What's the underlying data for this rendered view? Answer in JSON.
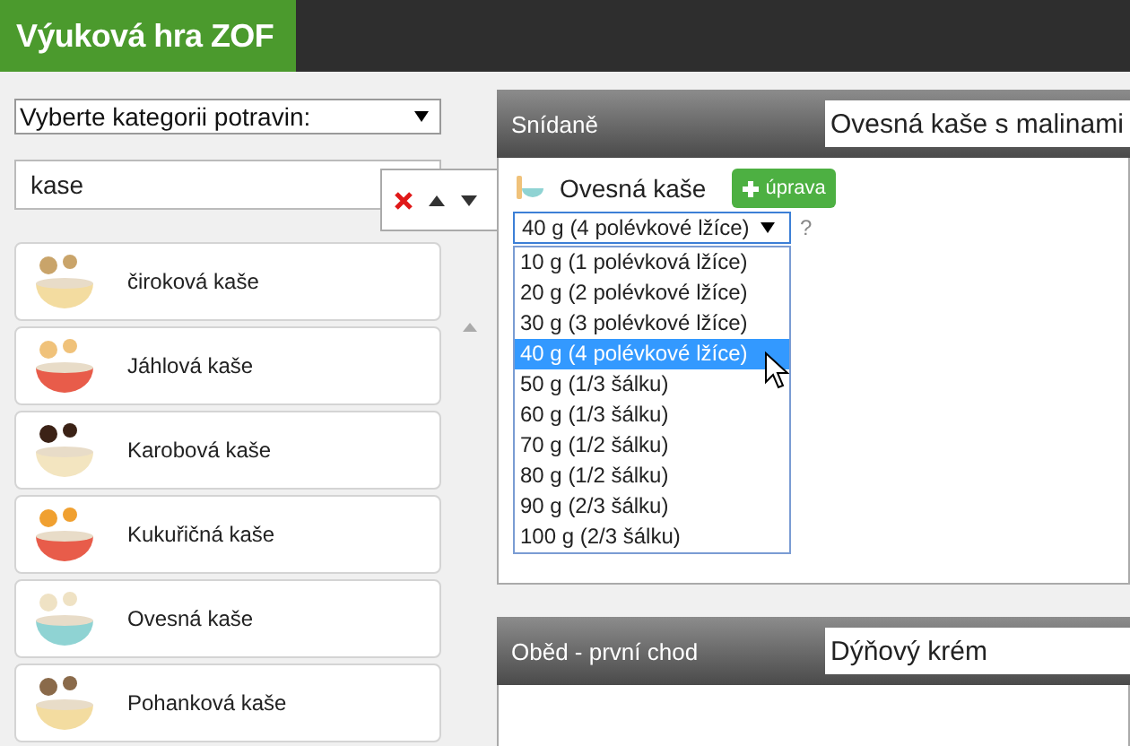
{
  "app": {
    "title": "Výuková hra ZOF"
  },
  "sidebar": {
    "category_select": {
      "value": "Vyberte kategorii potravin:"
    },
    "search": {
      "value": "kase"
    },
    "foods": [
      {
        "name": "čiroková kaše"
      },
      {
        "name": "Jáhlová kaše"
      },
      {
        "name": "Karobová kaše"
      },
      {
        "name": "Kukuřičná kaše"
      },
      {
        "name": "Ovesná kaše"
      },
      {
        "name": "Pohanková kaše"
      }
    ]
  },
  "meals": [
    {
      "title": "Snídaně",
      "dish": "Ovesná kaše s malinami",
      "items": [
        {
          "name": "Ovesná kaše",
          "edit_button": "úprava",
          "help": "?",
          "portion": {
            "value": "40 g (4 polévkové lžíce)",
            "expanded": true,
            "options": [
              {
                "label": "10 g (1 polévková lžíce)",
                "selected": false
              },
              {
                "label": "20 g (2 polévkové lžíce)",
                "selected": false
              },
              {
                "label": "30 g (3 polévkové lžíce)",
                "selected": false
              },
              {
                "label": "40 g (4 polévkové lžíce)",
                "selected": true
              },
              {
                "label": "50 g (1/3 šálku)",
                "selected": false
              },
              {
                "label": "60 g (1/3 šálku)",
                "selected": false
              },
              {
                "label": "70 g (1/2 šálku)",
                "selected": false
              },
              {
                "label": "80 g (1/2 šálku)",
                "selected": false
              },
              {
                "label": "90 g (2/3 šálku)",
                "selected": false
              },
              {
                "label": "100 g (2/3 šálku)",
                "selected": false
              }
            ]
          }
        }
      ]
    },
    {
      "title": "Oběd - první chod",
      "dish": "Dýňový krém"
    }
  ]
}
